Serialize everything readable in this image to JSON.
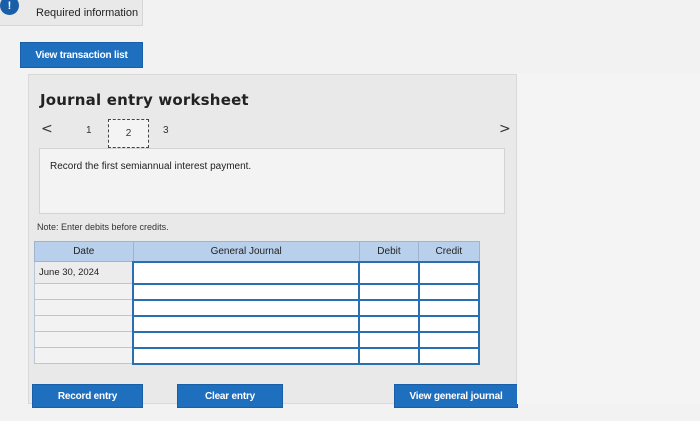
{
  "banner": {
    "icon_glyph": "!",
    "label": "Required information"
  },
  "buttons": {
    "view_transaction_list": "View transaction list",
    "record_entry": "Record entry",
    "clear_entry": "Clear entry",
    "view_general_journal": "View general journal"
  },
  "worksheet": {
    "title": "Journal entry worksheet",
    "nav_prev": "<",
    "nav_next": ">",
    "steps": [
      "1",
      "2",
      "3"
    ],
    "current_step": "2",
    "instruction": "Record the first semiannual interest payment.",
    "note": "Note: Enter debits before credits."
  },
  "journal_table": {
    "headers": {
      "date": "Date",
      "general_journal": "General Journal",
      "debit": "Debit",
      "credit": "Credit"
    },
    "rows": [
      {
        "date": "June 30, 2024",
        "account": "",
        "debit": "",
        "credit": ""
      },
      {
        "date": "",
        "account": "",
        "debit": "",
        "credit": ""
      },
      {
        "date": "",
        "account": "",
        "debit": "",
        "credit": ""
      },
      {
        "date": "",
        "account": "",
        "debit": "",
        "credit": ""
      },
      {
        "date": "",
        "account": "",
        "debit": "",
        "credit": ""
      },
      {
        "date": "",
        "account": "",
        "debit": "",
        "credit": ""
      }
    ]
  },
  "colors": {
    "button_blue": "#1f6fbf",
    "header_blue": "#b8d0ec",
    "input_border": "#2a6fb0",
    "info_icon": "#1a5ea8"
  }
}
